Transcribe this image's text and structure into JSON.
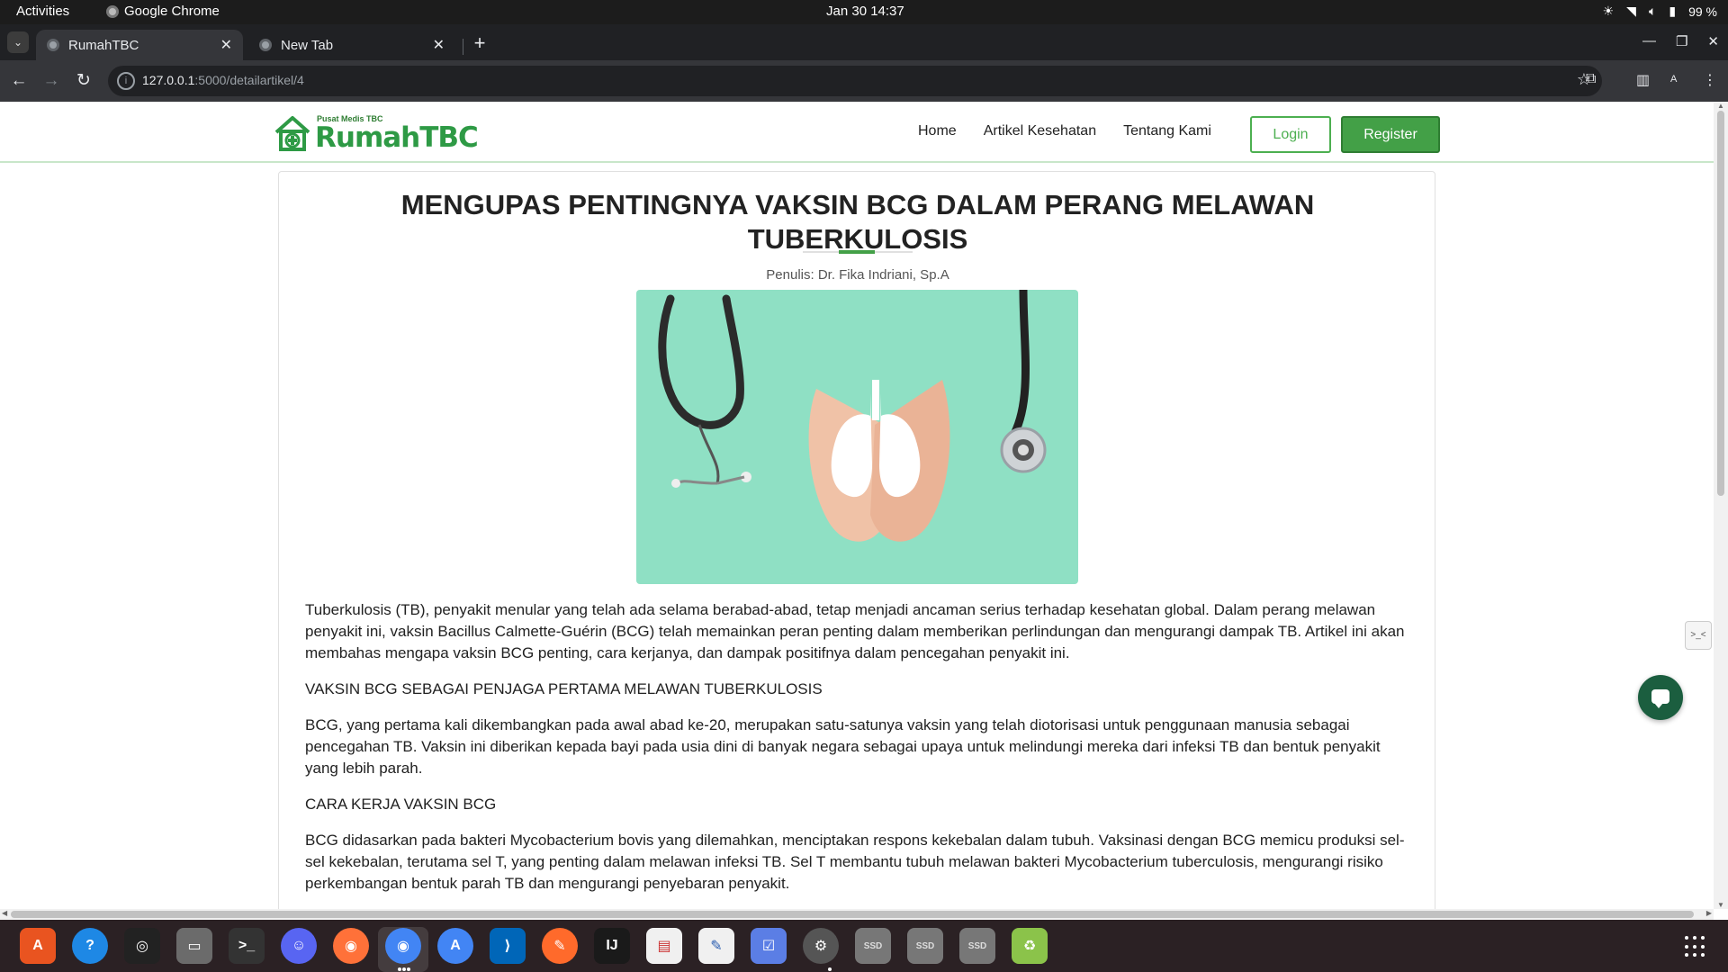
{
  "system": {
    "activities": "Activities",
    "app_name": "Google Chrome",
    "clock": "Jan 30  14:37",
    "battery": "99 %"
  },
  "browser": {
    "tabs": [
      {
        "label": "RumahTBC",
        "active": true
      },
      {
        "label": "New Tab",
        "active": false
      }
    ],
    "url_host": "127.0.0.1",
    "url_path": ":5000/detailartikel/4",
    "profile": "A"
  },
  "site": {
    "logo_subtitle": "Pusat Medis TBC",
    "logo_name": "RumahTBC",
    "nav": [
      "Home",
      "Artikel Kesehatan",
      "Tentang Kami"
    ],
    "login_label": "Login",
    "register_label": "Register",
    "brand_color": "#43a047"
  },
  "article": {
    "title": "MENGUPAS PENTINGNYA VAKSIN BCG DALAM PERANG MELAWAN TUBERKULOSIS",
    "author": "Penulis: Dr. Fika Indriani, Sp.A",
    "paragraphs": [
      "Tuberkulosis (TB), penyakit menular yang telah ada selama berabad-abad, tetap menjadi ancaman serius terhadap kesehatan global. Dalam perang melawan penyakit ini, vaksin Bacillus Calmette-Guérin (BCG) telah memainkan peran penting dalam memberikan perlindungan dan mengurangi dampak TB. Artikel ini akan membahas mengapa vaksin BCG penting, cara kerjanya, dan dampak positifnya dalam pencegahan penyakit ini.",
      "VAKSIN BCG SEBAGAI PENJAGA PERTAMA MELAWAN TUBERKULOSIS",
      "BCG, yang pertama kali dikembangkan pada awal abad ke-20, merupakan satu-satunya vaksin yang telah diotorisasi untuk penggunaan manusia sebagai pencegahan TB. Vaksin ini diberikan kepada bayi pada usia dini di banyak negara sebagai upaya untuk melindungi mereka dari infeksi TB dan bentuk penyakit yang lebih parah.",
      "CARA KERJA VAKSIN BCG",
      "BCG didasarkan pada bakteri Mycobacterium bovis yang dilemahkan, menciptakan respons kekebalan dalam tubuh. Vaksinasi dengan BCG memicu produksi sel-sel kekebalan, terutama sel T, yang penting dalam melawan infeksi TB. Sel T membantu tubuh melawan bakteri Mycobacterium tuberculosis, mengurangi risiko perkembangan bentuk parah TB dan mengurangi penyebaran penyakit."
    ]
  },
  "dock": {
    "items": [
      "app-center-icon",
      "help-icon",
      "rhythmbox-icon",
      "files-icon",
      "terminal-icon",
      "discord-icon",
      "firefox-icon",
      "chrome-icon",
      "android-studio-icon",
      "vscode-icon",
      "sketch-icon",
      "intellij-icon",
      "document-viewer-icon",
      "text-editor-icon",
      "tasks-icon",
      "settings-icon",
      "ssd-drive-icon",
      "ssd-drive-icon",
      "ssd-drive-icon",
      "trash-icon"
    ],
    "ssd_label": "SSD"
  }
}
